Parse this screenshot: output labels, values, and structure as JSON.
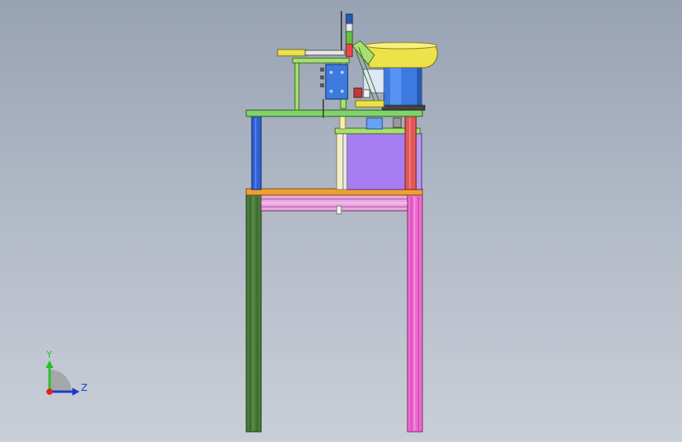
{
  "viewport": {
    "colors": {
      "background_top": "#97a2b3",
      "background_bottom": "#c9cfd8",
      "leg_left": "#4a7a3a",
      "leg_right": "#ee6bd0",
      "top_plate": "#f0a030",
      "upper_plate": "#7fd36a",
      "post_left": "#2f5fd0",
      "post_right": "#e05858",
      "cabinet": "#a77cf0",
      "bowl_rim": "#ece24a",
      "bowl_body": "#3c7ae0",
      "bracket": "#a8e070"
    }
  },
  "triad": {
    "y_label": "Y",
    "z_label": "Z",
    "icon": "coordinate-triad-icon"
  }
}
